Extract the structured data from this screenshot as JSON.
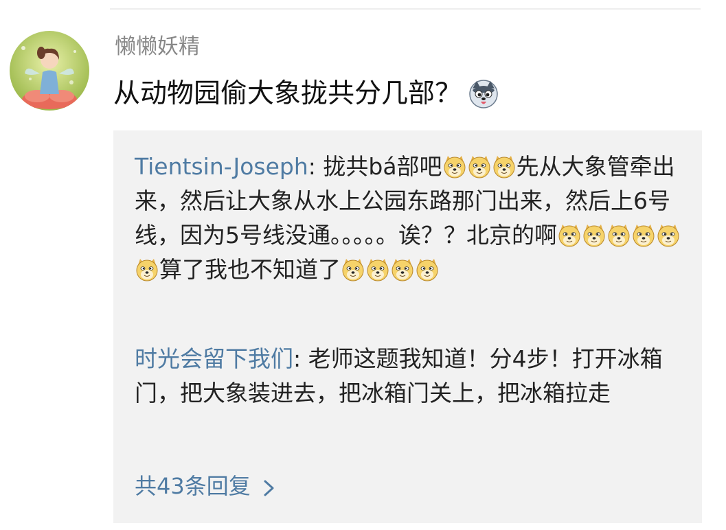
{
  "comment": {
    "username": "懒懒妖精",
    "text": "从动物园偷大象拢共分几部？",
    "avatar_icon": "fairy-on-flower-avatar",
    "emoji_icon": "husky-face-icon"
  },
  "replies": [
    {
      "author": "Tientsin-Joseph",
      "separator": ": ",
      "segments": [
        {
          "type": "text",
          "value": "拢共bá部吧"
        },
        {
          "type": "emoji",
          "icon": "doge-icon",
          "count": 3
        },
        {
          "type": "text",
          "value": "先从大象管牵出来，然后让大象从水上公园东路那门出来，然后上6号线，因为5号线没通。。。。。诶？？北京的啊"
        },
        {
          "type": "emoji",
          "icon": "doge-icon",
          "count": 6
        },
        {
          "type": "text",
          "value": "算了我也不知道了"
        },
        {
          "type": "emoji",
          "icon": "doge-icon",
          "count": 4
        }
      ]
    },
    {
      "author": "时光会留下我们",
      "separator": ": ",
      "segments": [
        {
          "type": "text",
          "value": "老师这题我知道！分4步！打开冰箱门，把大象装进去，把冰箱门关上，把冰箱拉走"
        }
      ]
    }
  ],
  "more_replies": {
    "label": "共43条回复",
    "icon": "chevron-right-icon"
  },
  "colors": {
    "link": "#4f7ba3",
    "reply_background": "#f2f2f2",
    "username": "#888888"
  }
}
